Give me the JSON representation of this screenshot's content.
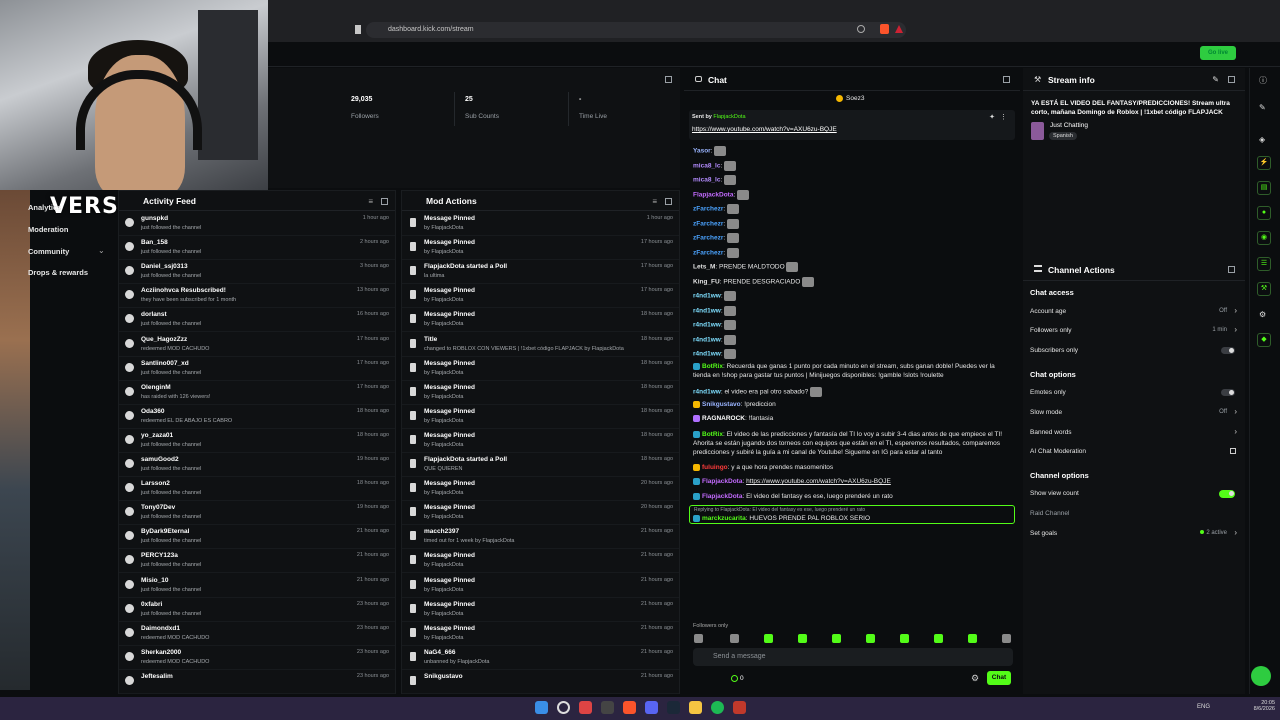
{
  "overlay": {
    "brand": "VERSUS"
  },
  "browser": {
    "url": "dashboard.kick.com/stream",
    "go_live": "Go live"
  },
  "stats": [
    {
      "value": "29,035",
      "label": "Followers"
    },
    {
      "value": "25",
      "label": "Sub Counts"
    },
    {
      "value": "-",
      "label": "Time Live"
    }
  ],
  "sidebar": {
    "items": [
      "Analytics",
      "Moderation",
      "Community",
      "Drops & rewards"
    ]
  },
  "activity": {
    "title": "Activity Feed",
    "rows": [
      {
        "user": "gunspkd",
        "action": "just followed the channel",
        "time": "1 hour ago"
      },
      {
        "user": "Ban_158",
        "action": "just followed the channel",
        "time": "2 hours ago"
      },
      {
        "user": "Daniel_ssj0313",
        "action": "just followed the channel",
        "time": "3 hours ago"
      },
      {
        "user": "Acziinohvca Resubscribed!",
        "action": "they have been subscribed for 1 month",
        "time": "13 hours ago"
      },
      {
        "user": "dorlanst",
        "action": "just followed the channel",
        "time": "16 hours ago"
      },
      {
        "user": "Que_HagozZzz",
        "action": "redeemed MOD CACHUDO",
        "time": "17 hours ago"
      },
      {
        "user": "Santlino007_xd",
        "action": "just followed the channel",
        "time": "17 hours ago"
      },
      {
        "user": "OlenginM",
        "action": "has raided with 126 viewers!",
        "time": "17 hours ago"
      },
      {
        "user": "Oda360",
        "action": "redeemed EL DE ABAJO ES CABRO",
        "time": "18 hours ago"
      },
      {
        "user": "yo_zaza01",
        "action": "just followed the channel",
        "time": "18 hours ago"
      },
      {
        "user": "samuGood2",
        "action": "just followed the channel",
        "time": "19 hours ago"
      },
      {
        "user": "Larsson2",
        "action": "just followed the channel",
        "time": "18 hours ago"
      },
      {
        "user": "Tony07Dev",
        "action": "just followed the channel",
        "time": "19 hours ago"
      },
      {
        "user": "ByDark9Eternal",
        "action": "just followed the channel",
        "time": "21 hours ago"
      },
      {
        "user": "PERCY123a",
        "action": "just followed the channel",
        "time": "21 hours ago"
      },
      {
        "user": "Misio_10",
        "action": "just followed the channel",
        "time": "21 hours ago"
      },
      {
        "user": "0xfabri",
        "action": "just followed the channel",
        "time": "23 hours ago"
      },
      {
        "user": "Daimondxd1",
        "action": "redeemed MOD CACHUDO",
        "time": "23 hours ago"
      },
      {
        "user": "Sherkan2000",
        "action": "redeemed MOD CACHUDO",
        "time": "23 hours ago"
      },
      {
        "user": "Jeftesalim",
        "action": "",
        "time": "23 hours ago"
      }
    ]
  },
  "mod": {
    "title": "Mod Actions",
    "rows": [
      {
        "t1": "Message Pinned",
        "t2": "by FlapjackDota",
        "time": "1 hour ago"
      },
      {
        "t1": "Message Pinned",
        "t2": "by FlapjackDota",
        "time": "17 hours ago"
      },
      {
        "t1": "FlapjackDota started a Poll",
        "t2": "la ultima",
        "time": "17 hours ago"
      },
      {
        "t1": "Message Pinned",
        "t2": "by FlapjackDota",
        "time": "17 hours ago"
      },
      {
        "t1": "Message Pinned",
        "t2": "by FlapjackDota",
        "time": "18 hours ago"
      },
      {
        "t1": "Title",
        "t2": "changed to ROBLOX CON VIEWERS | !1xbet código FLAPJACK by FlapjackDota",
        "time": "18 hours ago"
      },
      {
        "t1": "Message Pinned",
        "t2": "by FlapjackDota",
        "time": "18 hours ago"
      },
      {
        "t1": "Message Pinned",
        "t2": "by FlapjackDota",
        "time": "18 hours ago"
      },
      {
        "t1": "Message Pinned",
        "t2": "by FlapjackDota",
        "time": "18 hours ago"
      },
      {
        "t1": "Message Pinned",
        "t2": "by FlapjackDota",
        "time": "18 hours ago"
      },
      {
        "t1": "FlapjackDota started a Poll",
        "t2": "QUE QUIEREN",
        "time": "18 hours ago"
      },
      {
        "t1": "Message Pinned",
        "t2": "by FlapjackDota",
        "time": "20 hours ago"
      },
      {
        "t1": "Message Pinned",
        "t2": "by FlapjackDota",
        "time": "20 hours ago"
      },
      {
        "t1": "macch2397",
        "t2": "timed out for 1 week by FlapjackDota",
        "time": "21 hours ago"
      },
      {
        "t1": "Message Pinned",
        "t2": "by FlapjackDota",
        "time": "21 hours ago"
      },
      {
        "t1": "Message Pinned",
        "t2": "by FlapjackDota",
        "time": "21 hours ago"
      },
      {
        "t1": "Message Pinned",
        "t2": "by FlapjackDota",
        "time": "21 hours ago"
      },
      {
        "t1": "Message Pinned",
        "t2": "by FlapjackDota",
        "time": "21 hours ago"
      },
      {
        "t1": "NaG4_666",
        "t2": "unbanned by FlapjackDota",
        "time": "21 hours ago"
      },
      {
        "t1": "Snikgustavo",
        "t2": "",
        "time": "21 hours ago"
      }
    ]
  },
  "chat": {
    "title": "Chat",
    "host": "Soez3",
    "pinned_by": "Sent by",
    "pinned_user": "FlapjackDota",
    "pinned_link": "https://www.youtube.com/watch?v=AXU6zu-BQJE",
    "messages": [
      {
        "user": "Yasor",
        "color": "#9ab4ff",
        "text": ""
      },
      {
        "user": "mica8_lc",
        "color": "#b48cff",
        "text": ""
      },
      {
        "user": "mica8_lc",
        "color": "#b48cff",
        "text": ""
      },
      {
        "user": "FlapjackDota",
        "color": "#c36bff",
        "text": ""
      },
      {
        "user": "zFarchezr",
        "color": "#4ba3ff",
        "text": ""
      },
      {
        "user": "zFarchezr",
        "color": "#4ba3ff",
        "text": ""
      },
      {
        "user": "zFarchezr",
        "color": "#4ba3ff",
        "text": ""
      },
      {
        "user": "zFarchezr",
        "color": "#4ba3ff",
        "text": ""
      },
      {
        "user": "Lets_M",
        "color": "#e0e0e0",
        "text": "PRENDE MALDTODO"
      },
      {
        "user": "King_FU",
        "color": "#e0e0e0",
        "text": "PRENDE DESGRACIADO"
      },
      {
        "user": "r4nd1ww",
        "color": "#7fdfff",
        "text": ""
      },
      {
        "user": "r4nd1ww",
        "color": "#7fdfff",
        "text": ""
      },
      {
        "user": "r4nd1ww",
        "color": "#7fdfff",
        "text": ""
      },
      {
        "user": "r4nd1ww",
        "color": "#7fdfff",
        "text": ""
      },
      {
        "user": "r4nd1ww",
        "color": "#7fdfff",
        "text": ""
      }
    ],
    "botrix1": "Recuerda que ganas 1 punto por cada minuto en el stream, subs ganan doble! Puedes ver la",
    "botrix1b": "tienda en !shop para gastar tus puntos | Minijuegos disponibles: !gamble !slots !roulette",
    "r4msg": "el video era pal otro sabado?",
    "snik": "Snikgustavo",
    "snikmsg": "!prediccion",
    "ragna": "RAGNAROCK",
    "ragnamsg": "!fantasia",
    "botrix2a": "El video de las predicciones y fantasía del TI lo voy a subir 3-4 dias antes de que empiece el",
    "botrix2b": "TI! Ahorita se están jugando dos torneos con equipos que están en el TI, esperemos resultados,",
    "botrix2c": "comparemos predicciones y subiré la guía a mi canal de Youtube! Sigueme en IG para estar al tanto",
    "fuluingo": "fuluingo",
    "fulumsg": "y a que hora prendes masomenitos",
    "flapmsg1": "https://www.youtube.com/watch?v=AXU6zu-BQJE",
    "flapmsg2": "El video del fantasy es ese, luego prenderé un rato",
    "reply": "Replying to FlapjackDota: El video del fantasy es ese, luego prenderé un rato",
    "lastuser": "marckzucarita",
    "lastmsg": "HUEVOS PRENDE PAL ROBLOX SERIO",
    "followers_only": "Followers only",
    "placeholder": "Send a message",
    "count": "0",
    "button": "Chat"
  },
  "stream_info": {
    "title": "Stream info",
    "stream_title": "YA ESTÁ EL VIDEO DEL FANTASY/PREDICCIONES! Stream ultra corto, mañana Domingo de Roblox | !1xbet código FLAPJACK",
    "category": "Just Chatting",
    "language": "Spanish"
  },
  "channel_actions": {
    "title": "Channel Actions",
    "chat_access": "Chat access",
    "account_age": "Account age",
    "account_age_val": "Off",
    "followers_only": "Followers only",
    "followers_only_val": "1 min",
    "subscribers_only": "Subscribers only",
    "chat_options": "Chat options",
    "emotes_only": "Emotes only",
    "slow_mode": "Slow mode",
    "slow_mode_val": "Off",
    "banned_words": "Banned words",
    "ai_mod": "AI Chat Moderation",
    "channel_options": "Channel options",
    "show_view_count": "Show view count",
    "raid_channel": "Raid Channel",
    "set_goals": "Set goals",
    "set_goals_val": "2 active"
  },
  "taskbar": {
    "lang": "ENG",
    "time": "20:05",
    "date": "8/6/2026"
  },
  "colors": {
    "accent": "#53fc18",
    "bg": "#0b0d0f"
  }
}
